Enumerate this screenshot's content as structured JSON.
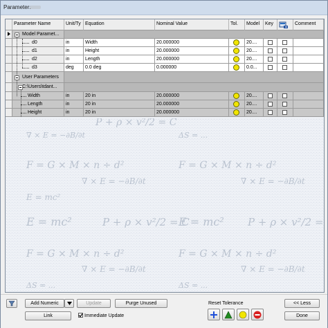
{
  "window": {
    "title": "Parameters"
  },
  "columns": {
    "name": "Parameter Name",
    "unit": "Unit/Ty",
    "equation": "Equation",
    "nominal": "Nominal Value",
    "tol": "Tol.",
    "model": "Model",
    "key": "Key",
    "comment": "Comment"
  },
  "groups": {
    "model": "Model Paramet...",
    "user": "User Parameters",
    "path": "C:\\Users\\tdant..."
  },
  "model_params": [
    {
      "name": "d0",
      "unit": "in",
      "equation": "Width",
      "nominal": "20.000000",
      "model": "20...."
    },
    {
      "name": "d1",
      "unit": "in",
      "equation": "Height",
      "nominal": "20.000000",
      "model": "20...."
    },
    {
      "name": "d2",
      "unit": "in",
      "equation": "Length",
      "nominal": "20.000000",
      "model": "20...."
    },
    {
      "name": "d3",
      "unit": "deg",
      "equation": "0.0 deg",
      "nominal": "0.000000",
      "model": "0.0..."
    }
  ],
  "user_params": [
    {
      "name": "Width",
      "unit": "in",
      "equation": "20 in",
      "nominal": "20.000000",
      "model": "20...."
    },
    {
      "name": "Length",
      "unit": "in",
      "equation": "20 in",
      "nominal": "20.000000",
      "model": "20...."
    },
    {
      "name": "Height",
      "unit": "in",
      "equation": "20 in",
      "nominal": "20.000000",
      "model": "20...."
    }
  ],
  "watermark": [
    "P + ρ × v²/2 = C",
    "∇ × E = −∂B/∂t",
    "F = G × M × n ÷ d²",
    "ΔS = ...",
    "E = mc²",
    "∇ × E = −∂B/∂t",
    "F = G × M × n ÷ d²"
  ],
  "bottom": {
    "add_numeric": "Add Numeric",
    "update": "Update",
    "purge_unused": "Purge Unused",
    "link": "Link",
    "immediate_update": "Immediate Update",
    "immediate_update_checked": true,
    "reset_tolerance": "Reset Tolerance",
    "less": "<< Less",
    "done": "Done"
  },
  "colors": {
    "tolerance_yellow": "#f2e600",
    "plus_blue": "#1f4fd8",
    "triangle_green": "#1f8a1f",
    "minus_red": "#d81f1f"
  }
}
